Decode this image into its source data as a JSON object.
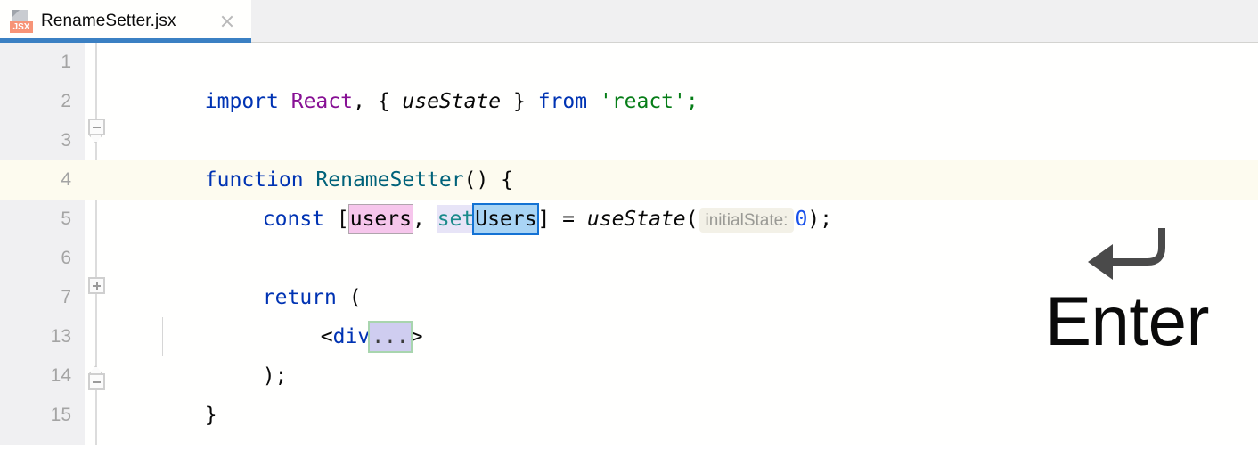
{
  "tab": {
    "filename": "RenameSetter.jsx",
    "icon": "jsx-file-icon",
    "badge": "JSX",
    "close_icon": "close-icon",
    "active": true,
    "accent_color": "#3b80c3"
  },
  "editor": {
    "current_line": 4,
    "current_line_bg": "#fdfbef",
    "gutter_bg": "#f0f0f2",
    "background": "#fffffe",
    "lines": [
      {
        "number": "1",
        "text": "import React, { useState } from 'react';"
      },
      {
        "number": "2",
        "text": ""
      },
      {
        "number": "3",
        "text": "function RenameSetter() {",
        "fold": "collapse"
      },
      {
        "number": "4",
        "text": "    const [users, setUsers] = useState( initialState: 0);",
        "current": true
      },
      {
        "number": "5",
        "text": ""
      },
      {
        "number": "6",
        "text": "    return ("
      },
      {
        "number": "7",
        "text": "        <div...>",
        "fold": "expand"
      },
      {
        "number": "13",
        "text": "    );"
      },
      {
        "number": "14",
        "text": "}",
        "fold": "collapse-end"
      },
      {
        "number": "15",
        "text": ""
      }
    ],
    "line1": {
      "import_kw": "import",
      "react_ident": "React",
      "comma_brace": ", { ",
      "usestate": "useState",
      "brace_close": " } ",
      "from_kw": "from",
      "module": " 'react';"
    },
    "line3": {
      "function_kw": "function",
      "name": "RenameSetter",
      "tail": "() {"
    },
    "line4": {
      "const_kw": "const",
      "bracket_open": " [",
      "users": "users",
      "separator": ", ",
      "set_prefix": "set",
      "setter_name": "Users",
      "bracket_close": "] = ",
      "usestate": "useState",
      "paren_open": "(",
      "inlay_hint": "initialState:",
      "value": "0",
      "tail": ");"
    },
    "line6": {
      "return_kw": "return",
      "tail": " ("
    },
    "line7": {
      "tag_open": "<",
      "tag_name": "div",
      "fold_placeholder": "...",
      "tag_close": ">"
    },
    "line13": {
      "text": ");"
    },
    "line14": {
      "text": "}"
    },
    "highlights": {
      "users_bg": "#f6c6ec",
      "set_bg": "#e7e4f7",
      "setter_bg": "#a9d4f5",
      "setter_border": "#1472d4",
      "fold_placeholder_bg": "#cfcdf0",
      "fold_placeholder_border": "#a8d5ae"
    }
  },
  "overlay": {
    "key_icon": "enter-return-arrow-icon",
    "key_label": "Enter"
  }
}
